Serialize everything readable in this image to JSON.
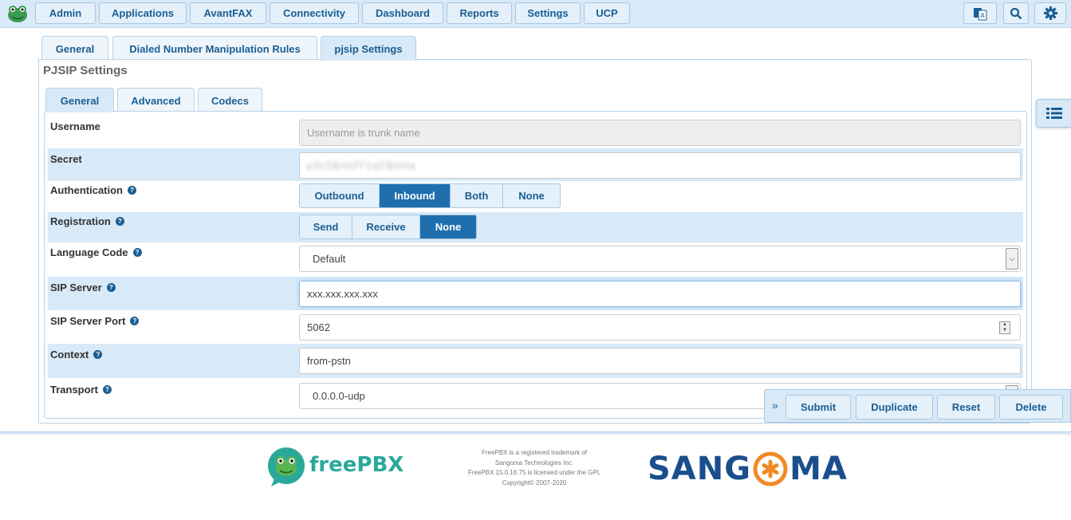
{
  "nav": {
    "items": [
      "Admin",
      "Applications",
      "AvantFAX",
      "Connectivity",
      "Dashboard",
      "Reports",
      "Settings",
      "UCP"
    ],
    "icons": [
      "translate-icon",
      "search-icon",
      "gear-icon"
    ]
  },
  "tabs": [
    "General",
    "Dialed Number Manipulation Rules",
    "pjsip Settings"
  ],
  "panel_title": "PJSIP Settings",
  "subtabs": [
    "General",
    "Advanced",
    "Codecs"
  ],
  "form": {
    "username": {
      "label": "Username",
      "placeholder": "Username is trunk name"
    },
    "secret": {
      "label": "Secret",
      "value": "pSr2BHsfY1qCBnHa"
    },
    "authentication": {
      "label": "Authentication",
      "options": [
        "Outbound",
        "Inbound",
        "Both",
        "None"
      ],
      "selected": "Inbound"
    },
    "registration": {
      "label": "Registration",
      "options": [
        "Send",
        "Receive",
        "None"
      ],
      "selected": "None"
    },
    "language_code": {
      "label": "Language Code",
      "value": "Default"
    },
    "sip_server": {
      "label": "SIP Server",
      "value": "xxx.xxx.xxx.xxx"
    },
    "sip_server_port": {
      "label": "SIP Server Port",
      "value": "5062"
    },
    "context": {
      "label": "Context",
      "value": "from-pstn"
    },
    "transport": {
      "label": "Transport",
      "value": "0.0.0.0-udp"
    }
  },
  "actions": {
    "toggle": "»",
    "submit": "Submit",
    "duplicate": "Duplicate",
    "reset": "Reset",
    "delete": "Delete"
  },
  "footer": {
    "freepbx_logo": "freePBX",
    "lines": [
      "FreePBX is a registered trademark of",
      "Sangoma Technologies Inc.",
      "FreePBX 15.0.16.75 is licensed under the GPL",
      "Copyright© 2007-2020"
    ],
    "sangoma_left": "SANG",
    "sangoma_right": "MA"
  },
  "colors": {
    "accent": "#1f6fae",
    "nav_bg": "#d8e9f7",
    "freepbx_green": "#2aa89a",
    "sangoma_blue": "#1a4e8c",
    "sangoma_orange": "#f08a24"
  }
}
